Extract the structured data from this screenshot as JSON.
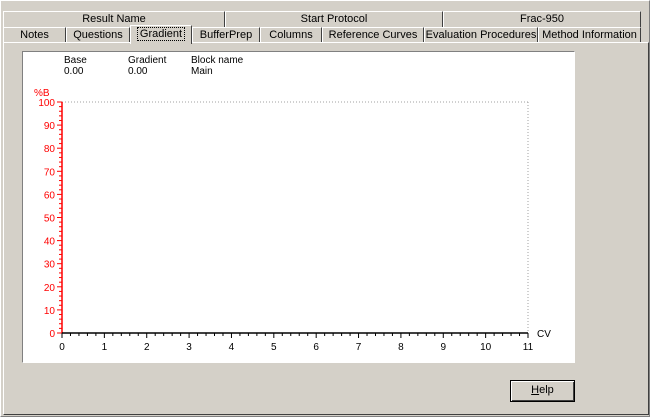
{
  "tabs_row1": [
    {
      "label": "Result Name"
    },
    {
      "label": "Start Protocol"
    },
    {
      "label": "Frac-950"
    }
  ],
  "tabs_row2": [
    {
      "label": "Notes"
    },
    {
      "label": "Questions"
    },
    {
      "label": "Gradient",
      "selected": true
    },
    {
      "label": "BufferPrep"
    },
    {
      "label": "Columns"
    },
    {
      "label": "Reference Curves"
    },
    {
      "label": "Evaluation Procedures"
    },
    {
      "label": "Method Information"
    }
  ],
  "gradient_info": {
    "base_label": "Base",
    "base_value": "0.00",
    "gradient_label": "Gradient",
    "gradient_value": "0.00",
    "block_label": "Block name",
    "block_value": "Main"
  },
  "help_button": {
    "label_prefix": "",
    "label_underlined": "H",
    "label_rest": "elp"
  },
  "colors": {
    "axis_y": "#ff0000",
    "axis_x": "#000000",
    "background": "#d4d0c8"
  },
  "chart_data": {
    "type": "line",
    "ylabel": "%B",
    "xlabel": "CV",
    "xlim": [
      0,
      11
    ],
    "ylim": [
      0,
      100
    ],
    "x_ticks": [
      "0",
      "1",
      "2",
      "3",
      "4",
      "5",
      "6",
      "7",
      "8",
      "9",
      "10",
      "11"
    ],
    "y_ticks": [
      "0",
      "10",
      "20",
      "30",
      "40",
      "50",
      "60",
      "70",
      "80",
      "90",
      "100"
    ],
    "series": [],
    "grid": false
  }
}
